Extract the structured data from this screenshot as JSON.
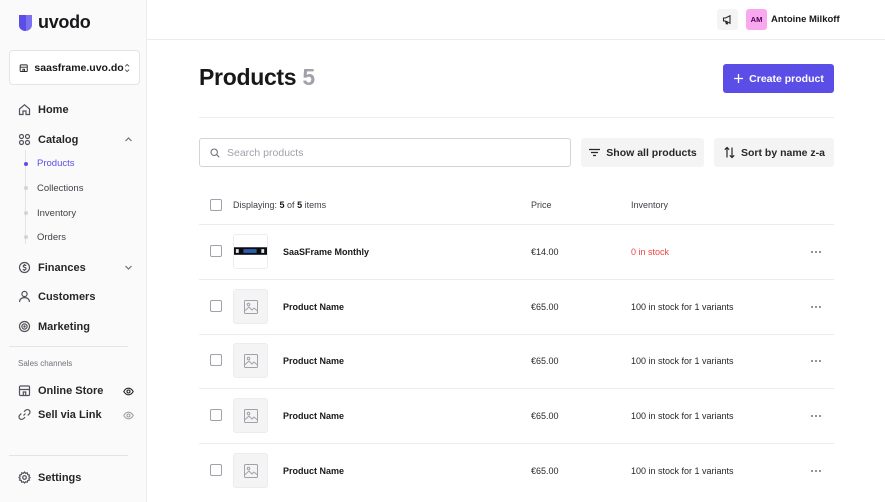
{
  "brand": {
    "name": "uvodo",
    "accent": "#5b4ee6"
  },
  "store_switcher": {
    "name": "saasframe.uvo.do"
  },
  "sidebar": {
    "home": "Home",
    "catalog": "Catalog",
    "catalog_items": [
      "Products",
      "Collections",
      "Inventory",
      "Orders"
    ],
    "finances": "Finances",
    "customers": "Customers",
    "marketing": "Marketing",
    "sales_channels_label": "Sales channels",
    "online_store": "Online Store",
    "sell_via_link": "Sell via Link",
    "settings": "Settings"
  },
  "topbar": {
    "avatar_initials": "AM",
    "user_name": "Antoine Milkoff"
  },
  "page": {
    "title": "Products",
    "count": "5",
    "create_label": "Create product"
  },
  "toolbar": {
    "search_placeholder": "Search products",
    "filter_label": "Show all products",
    "sort_label": "Sort by name z-a"
  },
  "table": {
    "displaying_prefix": "Displaying: ",
    "displaying_shown": "5",
    "displaying_of": " of ",
    "displaying_total": "5",
    "displaying_suffix": " items",
    "col_price": "Price",
    "col_inventory": "Inventory",
    "rows": [
      {
        "name": "SaaSFrame Monthly",
        "price": "€14.00",
        "inventory": "0 in stock"
      },
      {
        "name": "Product Name",
        "price": "€65.00",
        "inventory": "100 in stock for 1 variants"
      },
      {
        "name": "Product Name",
        "price": "€65.00",
        "inventory": "100 in stock for 1 variants"
      },
      {
        "name": "Product Name",
        "price": "€65.00",
        "inventory": "100 in stock for 1 variants"
      },
      {
        "name": "Product Name",
        "price": "€65.00",
        "inventory": "100 in stock for 1 variants"
      }
    ]
  }
}
